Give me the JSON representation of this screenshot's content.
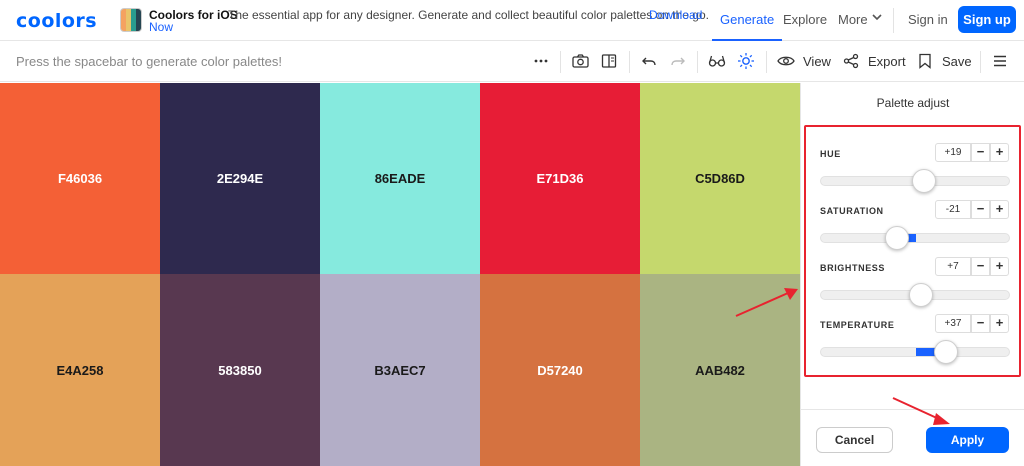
{
  "nav": {
    "logo": "coolors",
    "promo_title": "Coolors for iOS",
    "promo_desc": "The essential app for any designer. Generate and collect beautiful color palettes on the go.",
    "promo_link_a": "Download",
    "promo_link_b": "Now",
    "generate": "Generate",
    "explore": "Explore",
    "more": "More",
    "signin": "Sign in",
    "signup": "Sign up"
  },
  "toolbar": {
    "hint": "Press the spacebar to generate color palettes!",
    "view": "View",
    "export": "Export",
    "save": "Save",
    "icons": [
      "more-dots-icon",
      "camera-icon",
      "sidebar-icon",
      "undo-icon",
      "redo-icon",
      "glasses-icon",
      "sun-icon",
      "eye-icon",
      "share-icon",
      "bookmark-icon",
      "menu-icon"
    ]
  },
  "palette": {
    "top": [
      {
        "hex": "F46036",
        "color": "#F46036",
        "text": "#ffffff"
      },
      {
        "hex": "2E294E",
        "color": "#2E294E",
        "text": "#ffffff"
      },
      {
        "hex": "86EADE",
        "color": "#86EADE",
        "text": "#1a1a1a"
      },
      {
        "hex": "E71D36",
        "color": "#E71D36",
        "text": "#ffffff"
      },
      {
        "hex": "C5D86D",
        "color": "#C5D86D",
        "text": "#1a1a1a"
      }
    ],
    "bottom": [
      {
        "hex": "E4A258",
        "color": "#E4A258",
        "text": "#1a1a1a"
      },
      {
        "hex": "583850",
        "color": "#583850",
        "text": "#ffffff"
      },
      {
        "hex": "B3AEC7",
        "color": "#B3AEC7",
        "text": "#1a1a1a"
      },
      {
        "hex": "D57240",
        "color": "#D57240",
        "text": "#ffffff"
      },
      {
        "hex": "AAB482",
        "color": "#AAB482",
        "text": "#1a1a1a"
      }
    ]
  },
  "panel": {
    "title": "Palette adjust",
    "adjust": [
      {
        "label": "HUE",
        "value": "+19",
        "minus": "−",
        "plus": "+"
      },
      {
        "label": "SATURATION",
        "value": "-21",
        "minus": "−",
        "plus": "+"
      },
      {
        "label": "BRIGHTNESS",
        "value": "+7",
        "minus": "−",
        "plus": "+"
      },
      {
        "label": "TEMPERATURE",
        "value": "+37",
        "minus": "−",
        "plus": "+"
      }
    ],
    "cancel": "Cancel",
    "apply": "Apply"
  },
  "colors": {
    "accent": "#0066ff",
    "annotation": "#e8232f"
  }
}
